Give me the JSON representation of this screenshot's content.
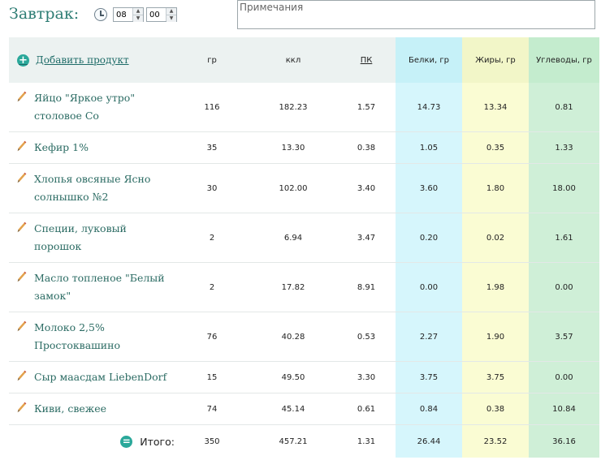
{
  "meal": {
    "title": "Завтрак:",
    "hour": "08",
    "minute": "00",
    "notes_placeholder": "Примечания"
  },
  "table": {
    "add_label": "Добавить продукт",
    "headers": {
      "gr": "гр",
      "kcal": "ккл",
      "pk": "ПК",
      "prot": "Белки, гр",
      "fat": "Жиры, гр",
      "carb": "Углеводы, гр"
    },
    "rows": [
      {
        "name": "Яйцо \"Яркое утро\" столовое Со",
        "gr": "116",
        "kcal": "182.23",
        "pk": "1.57",
        "prot": "14.73",
        "fat": "13.34",
        "carb": "0.81"
      },
      {
        "name": "Кефир 1%",
        "gr": "35",
        "kcal": "13.30",
        "pk": "0.38",
        "prot": "1.05",
        "fat": "0.35",
        "carb": "1.33"
      },
      {
        "name": "Хлопья овсяные Ясно солнышко №2",
        "gr": "30",
        "kcal": "102.00",
        "pk": "3.40",
        "prot": "3.60",
        "fat": "1.80",
        "carb": "18.00"
      },
      {
        "name": "Специи, луковый порошок",
        "gr": "2",
        "kcal": "6.94",
        "pk": "3.47",
        "prot": "0.20",
        "fat": "0.02",
        "carb": "1.61"
      },
      {
        "name": "Масло топленое \"Белый замок\"",
        "gr": "2",
        "kcal": "17.82",
        "pk": "8.91",
        "prot": "0.00",
        "fat": "1.98",
        "carb": "0.00"
      },
      {
        "name": "Молоко 2,5% Простоквашино",
        "gr": "76",
        "kcal": "40.28",
        "pk": "0.53",
        "prot": "2.27",
        "fat": "1.90",
        "carb": "3.57"
      },
      {
        "name": "Сыр маасдам LiebenDorf",
        "gr": "15",
        "kcal": "49.50",
        "pk": "3.30",
        "prot": "3.75",
        "fat": "3.75",
        "carb": "0.00"
      },
      {
        "name": "Киви, свежее",
        "gr": "74",
        "kcal": "45.14",
        "pk": "0.61",
        "prot": "0.84",
        "fat": "0.38",
        "carb": "10.84"
      }
    ],
    "total": {
      "label": "Итого:",
      "gr": "350",
      "kcal": "457.21",
      "pk": "1.31",
      "prot": "26.44",
      "fat": "23.52",
      "carb": "36.16"
    }
  },
  "colors": {
    "accent": "#2e7d74",
    "protein_bg": "#d6f6fc",
    "fat_bg": "#fafcd3",
    "carb_bg": "#cfefd7"
  }
}
